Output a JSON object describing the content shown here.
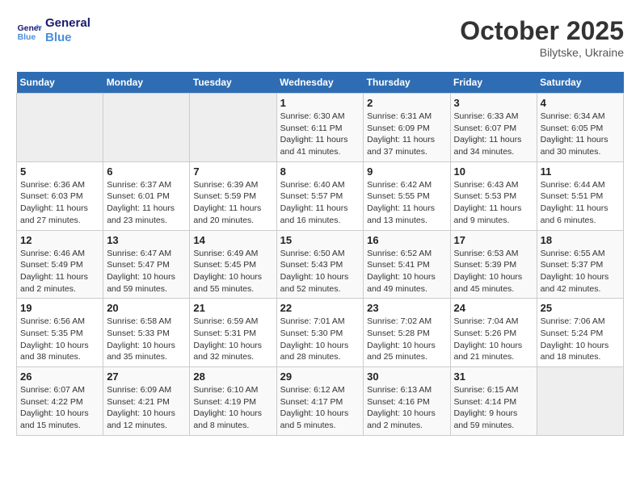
{
  "logo": {
    "line1": "General",
    "line2": "Blue"
  },
  "title": "October 2025",
  "subtitle": "Bilytske, Ukraine",
  "days_of_week": [
    "Sunday",
    "Monday",
    "Tuesday",
    "Wednesday",
    "Thursday",
    "Friday",
    "Saturday"
  ],
  "weeks": [
    [
      {
        "num": "",
        "info": ""
      },
      {
        "num": "",
        "info": ""
      },
      {
        "num": "",
        "info": ""
      },
      {
        "num": "1",
        "info": "Sunrise: 6:30 AM\nSunset: 6:11 PM\nDaylight: 11 hours\nand 41 minutes."
      },
      {
        "num": "2",
        "info": "Sunrise: 6:31 AM\nSunset: 6:09 PM\nDaylight: 11 hours\nand 37 minutes."
      },
      {
        "num": "3",
        "info": "Sunrise: 6:33 AM\nSunset: 6:07 PM\nDaylight: 11 hours\nand 34 minutes."
      },
      {
        "num": "4",
        "info": "Sunrise: 6:34 AM\nSunset: 6:05 PM\nDaylight: 11 hours\nand 30 minutes."
      }
    ],
    [
      {
        "num": "5",
        "info": "Sunrise: 6:36 AM\nSunset: 6:03 PM\nDaylight: 11 hours\nand 27 minutes."
      },
      {
        "num": "6",
        "info": "Sunrise: 6:37 AM\nSunset: 6:01 PM\nDaylight: 11 hours\nand 23 minutes."
      },
      {
        "num": "7",
        "info": "Sunrise: 6:39 AM\nSunset: 5:59 PM\nDaylight: 11 hours\nand 20 minutes."
      },
      {
        "num": "8",
        "info": "Sunrise: 6:40 AM\nSunset: 5:57 PM\nDaylight: 11 hours\nand 16 minutes."
      },
      {
        "num": "9",
        "info": "Sunrise: 6:42 AM\nSunset: 5:55 PM\nDaylight: 11 hours\nand 13 minutes."
      },
      {
        "num": "10",
        "info": "Sunrise: 6:43 AM\nSunset: 5:53 PM\nDaylight: 11 hours\nand 9 minutes."
      },
      {
        "num": "11",
        "info": "Sunrise: 6:44 AM\nSunset: 5:51 PM\nDaylight: 11 hours\nand 6 minutes."
      }
    ],
    [
      {
        "num": "12",
        "info": "Sunrise: 6:46 AM\nSunset: 5:49 PM\nDaylight: 11 hours\nand 2 minutes."
      },
      {
        "num": "13",
        "info": "Sunrise: 6:47 AM\nSunset: 5:47 PM\nDaylight: 10 hours\nand 59 minutes."
      },
      {
        "num": "14",
        "info": "Sunrise: 6:49 AM\nSunset: 5:45 PM\nDaylight: 10 hours\nand 55 minutes."
      },
      {
        "num": "15",
        "info": "Sunrise: 6:50 AM\nSunset: 5:43 PM\nDaylight: 10 hours\nand 52 minutes."
      },
      {
        "num": "16",
        "info": "Sunrise: 6:52 AM\nSunset: 5:41 PM\nDaylight: 10 hours\nand 49 minutes."
      },
      {
        "num": "17",
        "info": "Sunrise: 6:53 AM\nSunset: 5:39 PM\nDaylight: 10 hours\nand 45 minutes."
      },
      {
        "num": "18",
        "info": "Sunrise: 6:55 AM\nSunset: 5:37 PM\nDaylight: 10 hours\nand 42 minutes."
      }
    ],
    [
      {
        "num": "19",
        "info": "Sunrise: 6:56 AM\nSunset: 5:35 PM\nDaylight: 10 hours\nand 38 minutes."
      },
      {
        "num": "20",
        "info": "Sunrise: 6:58 AM\nSunset: 5:33 PM\nDaylight: 10 hours\nand 35 minutes."
      },
      {
        "num": "21",
        "info": "Sunrise: 6:59 AM\nSunset: 5:31 PM\nDaylight: 10 hours\nand 32 minutes."
      },
      {
        "num": "22",
        "info": "Sunrise: 7:01 AM\nSunset: 5:30 PM\nDaylight: 10 hours\nand 28 minutes."
      },
      {
        "num": "23",
        "info": "Sunrise: 7:02 AM\nSunset: 5:28 PM\nDaylight: 10 hours\nand 25 minutes."
      },
      {
        "num": "24",
        "info": "Sunrise: 7:04 AM\nSunset: 5:26 PM\nDaylight: 10 hours\nand 21 minutes."
      },
      {
        "num": "25",
        "info": "Sunrise: 7:06 AM\nSunset: 5:24 PM\nDaylight: 10 hours\nand 18 minutes."
      }
    ],
    [
      {
        "num": "26",
        "info": "Sunrise: 6:07 AM\nSunset: 4:22 PM\nDaylight: 10 hours\nand 15 minutes."
      },
      {
        "num": "27",
        "info": "Sunrise: 6:09 AM\nSunset: 4:21 PM\nDaylight: 10 hours\nand 12 minutes."
      },
      {
        "num": "28",
        "info": "Sunrise: 6:10 AM\nSunset: 4:19 PM\nDaylight: 10 hours\nand 8 minutes."
      },
      {
        "num": "29",
        "info": "Sunrise: 6:12 AM\nSunset: 4:17 PM\nDaylight: 10 hours\nand 5 minutes."
      },
      {
        "num": "30",
        "info": "Sunrise: 6:13 AM\nSunset: 4:16 PM\nDaylight: 10 hours\nand 2 minutes."
      },
      {
        "num": "31",
        "info": "Sunrise: 6:15 AM\nSunset: 4:14 PM\nDaylight: 9 hours\nand 59 minutes."
      },
      {
        "num": "",
        "info": ""
      }
    ]
  ]
}
